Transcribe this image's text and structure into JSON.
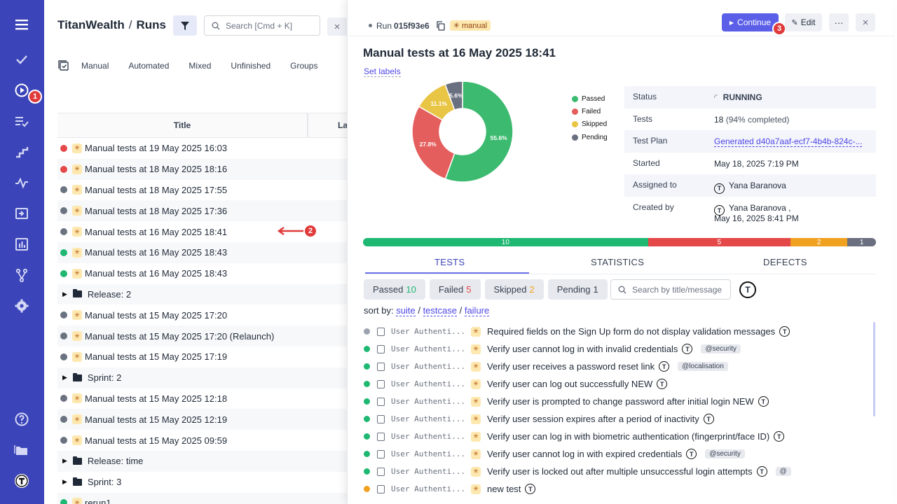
{
  "nav": {
    "badge_runs": "1"
  },
  "left": {
    "breadcrumb_project": "TitanWealth",
    "breadcrumb_sep": "/",
    "breadcrumb_page": "Runs",
    "search_placeholder": "Search [Cmd + K]",
    "filter_tabs": [
      "Manual",
      "Automated",
      "Mixed",
      "Unfinished",
      "Groups"
    ],
    "col_title": "Title",
    "col_last": "La",
    "arrow_badge": "2",
    "rows": [
      {
        "type": "run",
        "status": "failed",
        "label": "Manual tests at 19 May 2025 16:03"
      },
      {
        "type": "run",
        "status": "failed",
        "label": "Manual tests at 18 May 2025 18:16"
      },
      {
        "type": "run",
        "status": "running",
        "label": "Manual tests at 18 May 2025 17:55"
      },
      {
        "type": "run",
        "status": "running",
        "label": "Manual tests at 18 May 2025 17:36"
      },
      {
        "type": "run",
        "status": "running",
        "label": "Manual tests at 16 May 2025 18:41"
      },
      {
        "type": "run",
        "status": "passed",
        "label": "Manual tests at 16 May 2025 18:43"
      },
      {
        "type": "run",
        "status": "passed",
        "label": "Manual tests at 16 May 2025 18:43"
      },
      {
        "type": "folder",
        "label": "Release: 2"
      },
      {
        "type": "run",
        "status": "running",
        "label": "Manual tests at 15 May 2025 17:20"
      },
      {
        "type": "run",
        "status": "running",
        "label": "Manual tests at 15 May 2025 17:20 (Relaunch)"
      },
      {
        "type": "run",
        "status": "running",
        "label": "Manual tests at 15 May 2025 17:19"
      },
      {
        "type": "folder",
        "label": "Sprint: 2"
      },
      {
        "type": "run",
        "status": "running",
        "label": "Manual tests at 15 May 2025 12:18"
      },
      {
        "type": "run",
        "status": "running",
        "label": "Manual tests at 15 May 2025 12:19"
      },
      {
        "type": "run",
        "status": "running",
        "label": "Manual tests at 15 May 2025 09:59"
      },
      {
        "type": "folder",
        "label": "Release: time"
      },
      {
        "type": "folder",
        "label": "Sprint: 3"
      },
      {
        "type": "run",
        "status": "passed",
        "label": "rerun1"
      }
    ]
  },
  "detail": {
    "run_prefix": "Run",
    "run_id": "015f93e6",
    "run_type": "manual",
    "continue_label": "Continue",
    "continue_badge": "3",
    "edit_label": "Edit",
    "more_label": "···",
    "title": "Manual tests at 16 May 2025 18:41",
    "set_labels": "Set labels",
    "legend": [
      {
        "label": "Passed",
        "color": "#3cba6f"
      },
      {
        "label": "Failed",
        "color": "#e55e5e"
      },
      {
        "label": "Skipped",
        "color": "#e9c546"
      },
      {
        "label": "Pending",
        "color": "#6b7080"
      }
    ],
    "info": {
      "status_label": "Status",
      "status_value": "RUNNING",
      "tests_label": "Tests",
      "tests_count": "18",
      "tests_completed": "(94% completed)",
      "plan_label": "Test Plan",
      "plan_value": "Generated d40a7aaf-ecf7-4b4b-824c-...",
      "started_label": "Started",
      "started_value": "May 18, 2025 7:19 PM",
      "assigned_label": "Assigned to",
      "assigned_value": "Yana Baranova",
      "created_label": "Created by",
      "created_value": "Yana Baranova ,",
      "created_date": "May 16, 2025 8:41 PM"
    },
    "progress": [
      {
        "value": 10,
        "color": "#1eb872"
      },
      {
        "value": 5,
        "color": "#e54848"
      },
      {
        "value": 2,
        "color": "#f0a120"
      },
      {
        "value": 1,
        "color": "#6b7080"
      }
    ],
    "tabs": [
      "TESTS",
      "STATISTICS",
      "DEFECTS"
    ],
    "chips": [
      {
        "label": "Passed",
        "count": "10",
        "color": "#1eb872"
      },
      {
        "label": "Failed",
        "count": "5",
        "color": "#e54848"
      },
      {
        "label": "Skipped",
        "count": "2",
        "color": "#f0a120"
      },
      {
        "label": "Pending",
        "count": "1",
        "color": "#374151"
      }
    ],
    "test_search_placeholder": "Search by title/message",
    "sort_prefix": "sort by:",
    "sort_suite": "suite",
    "sort_testcase": "testcase",
    "sort_failure": "failure",
    "tests": [
      {
        "status": "pending",
        "suite": "User Authenti...",
        "name": "Required fields on the Sign Up form do not display validation messages",
        "tag": ""
      },
      {
        "status": "passed",
        "suite": "User Authenti...",
        "name": "Verify user cannot log in with invalid credentials",
        "tag": "@security"
      },
      {
        "status": "passed",
        "suite": "User Authenti...",
        "name": "Verify user receives a password reset link",
        "tag": "@localisation"
      },
      {
        "status": "passed",
        "suite": "User Authenti...",
        "name": "Verify user can log out successfully NEW",
        "tag": ""
      },
      {
        "status": "passed",
        "suite": "User Authenti...",
        "name": "Verify user is prompted to change password after initial login NEW",
        "tag": ""
      },
      {
        "status": "passed",
        "suite": "User Authenti...",
        "name": "Verify user session expires after a period of inactivity",
        "tag": ""
      },
      {
        "status": "passed",
        "suite": "User Authenti...",
        "name": "Verify user can log in with biometric authentication (fingerprint/face ID)",
        "tag": ""
      },
      {
        "status": "passed",
        "suite": "User Authenti...",
        "name": "Verify user cannot log in with expired credentials",
        "tag": "@security"
      },
      {
        "status": "passed",
        "suite": "User Authenti...",
        "name": "Verify user is locked out after multiple unsuccessful login attempts",
        "tag": "@"
      },
      {
        "status": "skipped",
        "suite": "User Authenti...",
        "name": "new test",
        "tag": ""
      }
    ]
  },
  "chart_data": {
    "type": "pie",
    "categories": [
      "Passed",
      "Failed",
      "Skipped",
      "Pending"
    ],
    "values": [
      55.6,
      27.8,
      11.1,
      5.6
    ],
    "labels": [
      "55.6%",
      "27.8%",
      "11.1%",
      "5.6%"
    ],
    "colors": [
      "#3cba6f",
      "#e55e5e",
      "#e9c546",
      "#6b7080"
    ],
    "donut": true,
    "legend_position": "right"
  }
}
